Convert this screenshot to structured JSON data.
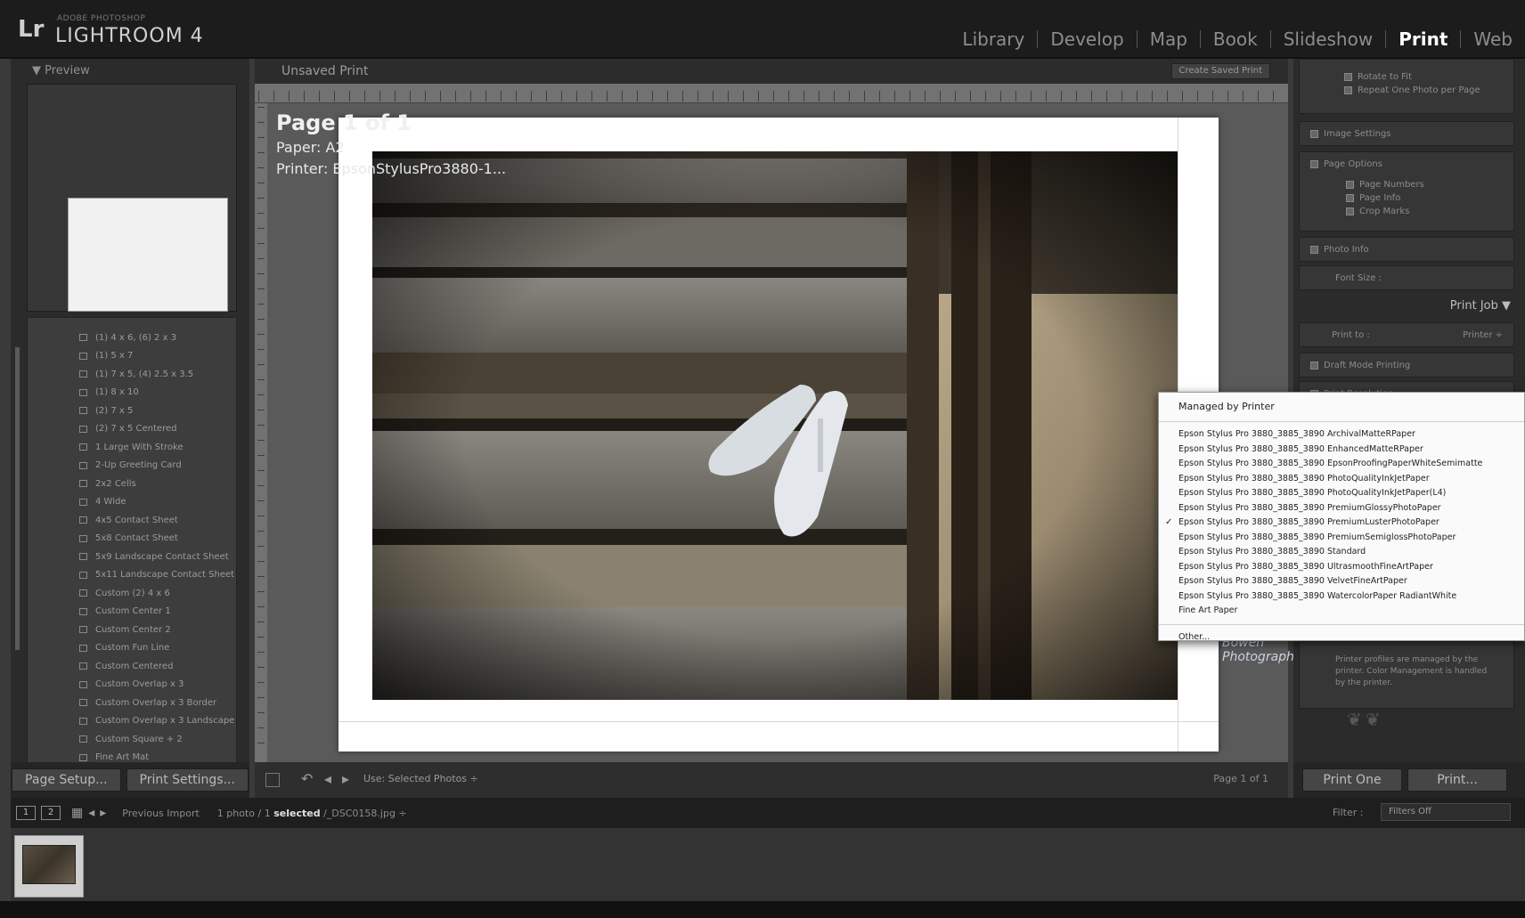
{
  "app": {
    "title_small": "ADOBE PHOTOSHOP",
    "title": "LIGHTROOM 4",
    "logo": "Lr"
  },
  "modules": [
    {
      "label": "Library",
      "active": false
    },
    {
      "label": "Develop",
      "active": false
    },
    {
      "label": "Map",
      "active": false
    },
    {
      "label": "Book",
      "active": false
    },
    {
      "label": "Slideshow",
      "active": false
    },
    {
      "label": "Print",
      "active": true
    },
    {
      "label": "Web",
      "active": false
    }
  ],
  "left_panel": {
    "preview_header": "▼ Preview",
    "templates": [
      "(1) 4 x 6, (6) 2 x 3",
      "(1) 5 x 7",
      "(1) 7 x 5, (4) 2.5 x 3.5",
      "(1) 8 x 10",
      "(2) 7 x 5",
      "(2) 7 x 5 Centered",
      "1 Large With Stroke",
      "2-Up Greeting Card",
      "2x2 Cells",
      "4 Wide",
      "4x5 Contact Sheet",
      "5x8 Contact Sheet",
      "5x9 Landscape Contact Sheet",
      "5x11 Landscape Contact Sheet",
      "Custom (2) 4 x 6",
      "Custom Center 1",
      "Custom Center 2",
      "Custom Fun Line",
      "Custom Centered",
      "Custom Overlap x 3",
      "Custom Overlap x 3 Border",
      "Custom Overlap x 3 Landscape",
      "Custom Square + 2",
      "Fine Art Mat"
    ],
    "buttons": {
      "page_setup": "Page Setup...",
      "print_settings": "Print Settings..."
    }
  },
  "center": {
    "header_title": "Unsaved Print",
    "header_right": "Create Saved Print",
    "page_count": "Page 1 of 1",
    "paper": "Paper:  A2",
    "printer": "Printer:  EpsonStylusPro3880-1...",
    "watermark": "Bowen Photography",
    "toolbar": {
      "use_label": "Use:  Selected Photos ÷",
      "page_of": "Page 1 of 1"
    }
  },
  "right_panel": {
    "rows_top": [
      "Rotate to Fit",
      "Repeat One Photo per Page"
    ],
    "image_settings_label": "Image Settings",
    "page_options_label": "Page Options",
    "page_options_items": [
      "Page Numbers",
      "Page Info",
      "Crop Marks"
    ],
    "photo_info_label": "Photo Info",
    "font_size_label": "Font Size :",
    "print_job_label": "Print Job ▼",
    "print_to_label": "Print to :",
    "print_to_value": "Printer ÷",
    "draft_mode_label": "Draft Mode Printing",
    "print_resolution_label": "Print Resolution",
    "profile_note": "Printer profiles are managed by the printer. Color Management is handled by the printer.",
    "buttons": {
      "print_one": "Print One",
      "print": "Print..."
    }
  },
  "dropdown": {
    "header": "Managed by Printer",
    "items": [
      {
        "label": "Epson Stylus Pro 3880_3885_3890 ArchivalMatteRPaper",
        "checked": false
      },
      {
        "label": "Epson Stylus Pro 3880_3885_3890 EnhancedMatteRPaper",
        "checked": false
      },
      {
        "label": "Epson Stylus Pro 3880_3885_3890 EpsonProofingPaperWhiteSemimatte",
        "checked": false
      },
      {
        "label": "Epson Stylus Pro 3880_3885_3890 PhotoQualityInkJetPaper",
        "checked": false
      },
      {
        "label": "Epson Stylus Pro 3880_3885_3890 PhotoQualityInkJetPaper(L4)",
        "checked": false
      },
      {
        "label": "Epson Stylus Pro 3880_3885_3890 PremiumGlossyPhotoPaper",
        "checked": false
      },
      {
        "label": "Epson Stylus Pro 3880_3885_3890 PremiumLusterPhotoPaper",
        "checked": true
      },
      {
        "label": "Epson Stylus Pro 3880_3885_3890 PremiumSemiglossPhotoPaper",
        "checked": false
      },
      {
        "label": "Epson Stylus Pro 3880_3885_3890 Standard",
        "checked": false
      },
      {
        "label": "Epson Stylus Pro 3880_3885_3890 UltrasmoothFineArtPaper",
        "checked": false
      },
      {
        "label": "Epson Stylus Pro 3880_3885_3890 VelvetFineArtPaper",
        "checked": false
      },
      {
        "label": "Epson Stylus Pro 3880_3885_3890 WatercolorPaper RadiantWhite",
        "checked": false
      },
      {
        "label": "Fine Art Paper",
        "checked": false
      }
    ],
    "other": "Other..."
  },
  "filmstrip": {
    "view_1": "1",
    "view_2": "2",
    "source": "Previous Import",
    "path_prefix": "1 photo / 1",
    "path_selected": "selected",
    "path_file": "/_DSC0158.jpg ÷",
    "filter_label": "Filter :",
    "filter_value": "Filters Off"
  }
}
